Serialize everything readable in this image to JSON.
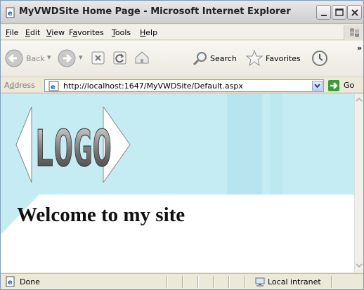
{
  "window": {
    "title": "MyVWDSite Home Page - Microsoft Internet Explorer"
  },
  "menu": {
    "items": [
      {
        "key": "F",
        "rest": "ile"
      },
      {
        "key": "E",
        "rest": "dit"
      },
      {
        "key": "V",
        "rest": "iew"
      },
      {
        "pre": "F",
        "key": "a",
        "rest": "vorites"
      },
      {
        "key": "T",
        "rest": "ools"
      },
      {
        "key": "H",
        "rest": "elp"
      }
    ]
  },
  "toolbar": {
    "back_label": "Back",
    "search_label": "Search",
    "favorites_label": "Favorites",
    "overflow": "»"
  },
  "address": {
    "label_pre": "A",
    "label_key": "d",
    "label_rest": "dress",
    "url": "http://localhost:1647/MyVWDSite/Default.aspx",
    "go_label": "Go"
  },
  "page": {
    "logo_text": "LOGO",
    "heading": "Welcome to my site"
  },
  "status": {
    "text": "Done",
    "zone": "Local intranet"
  },
  "colors": {
    "watermark": "#c6ecf3",
    "go_green": "#3b9a3b",
    "title_text": "#222222"
  }
}
